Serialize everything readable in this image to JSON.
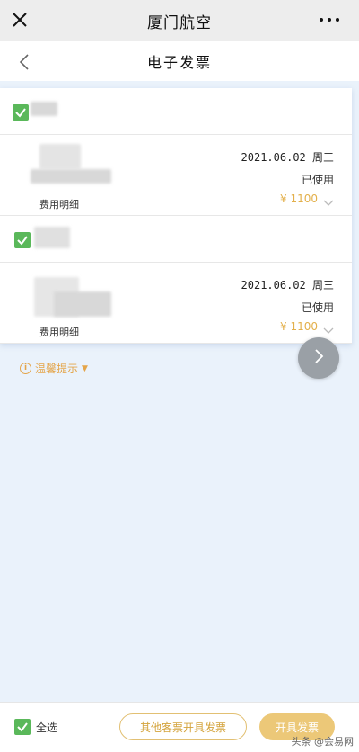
{
  "top_bar": {
    "title": "厦门航空",
    "close_icon": "close-icon",
    "more_icon": "more-icon"
  },
  "sub_header": {
    "title": "电子发票",
    "back_icon": "chevron-left-icon"
  },
  "orders": [
    {
      "items": [
        {
          "date": "2021.06.02 周三",
          "status": "已使用",
          "price": "¥ 1100",
          "detail_label": "费用明细"
        }
      ]
    },
    {
      "items": [
        {
          "date": "2021.06.02 周三",
          "status": "已使用",
          "price": "¥ 1100",
          "detail_label": "费用明细"
        }
      ]
    }
  ],
  "tip": {
    "label": "温馨提示",
    "icon": "info-icon",
    "caret": "▼"
  },
  "bottom_bar": {
    "select_all_label": "全选",
    "other_invoice_button": "其他客票开具发票",
    "issue_invoice_button": "开具发票"
  },
  "watermark": "头条 @会易网",
  "colors": {
    "accent_gold": "#e3b04b",
    "check_green": "#5ab85a",
    "background": "#eaf2fb"
  }
}
